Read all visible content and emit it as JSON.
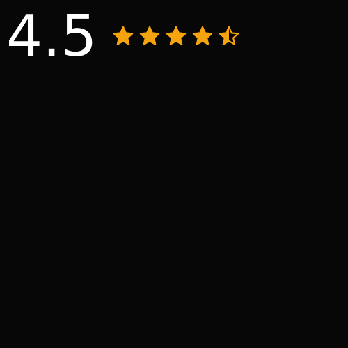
{
  "rating": {
    "value": "4.5",
    "max": 5,
    "stars_filled": 4.5
  },
  "colors": {
    "background": "#070707",
    "value_text": "#ffffff",
    "star_fill": "#f5a30f"
  },
  "icons": {
    "full_star": "star-filled-icon",
    "half_star": "star-half-icon",
    "empty_star": "star-empty-icon"
  }
}
